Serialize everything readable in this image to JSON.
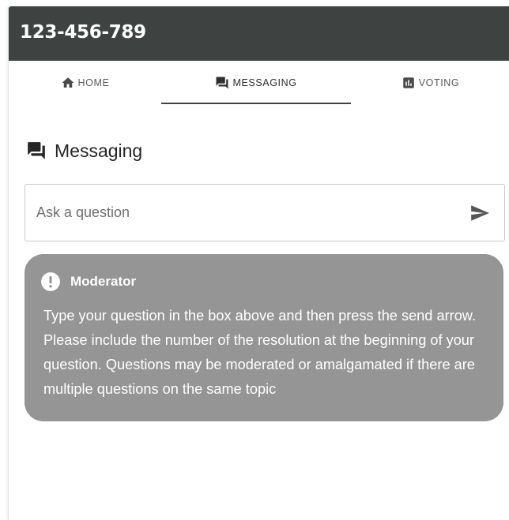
{
  "header": {
    "title": "123-456-789"
  },
  "nav": {
    "tabs": [
      {
        "label": "HOME",
        "icon": "home-icon"
      },
      {
        "label": "MESSAGING",
        "icon": "chat-icon",
        "active": true
      },
      {
        "label": "VOTING",
        "icon": "bar-chart-icon"
      }
    ]
  },
  "section": {
    "title": "Messaging",
    "icon": "chat-icon"
  },
  "ask": {
    "placeholder": "Ask a question",
    "value": "",
    "send_icon": "send-icon"
  },
  "moderator": {
    "name": "Moderator",
    "icon": "exclamation-icon",
    "message": "Type your question in the box above and then press the send arrow. Please include the number of the resolution at the beginning of your question. Questions may be moderated or amalgamated if there are multiple questions on the same topic"
  },
  "colors": {
    "header_bg": "#3e4341",
    "card_bg": "#959595",
    "text_dark": "#262626"
  }
}
